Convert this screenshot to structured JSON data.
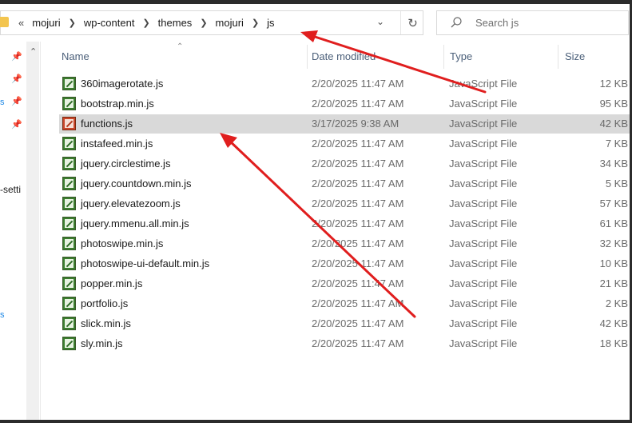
{
  "address": {
    "overflow_chevron": "«",
    "crumbs": [
      "mojuri",
      "wp-content",
      "themes",
      "mojuri",
      "js"
    ],
    "dropdown_icon": "chevron-down-icon",
    "refresh_icon": "refresh-icon"
  },
  "search": {
    "placeholder": "Search js",
    "icon": "search-icon"
  },
  "nav": {
    "partial_label": "-setti"
  },
  "columns": {
    "name": "Name",
    "date": "Date modified",
    "type": "Type",
    "size": "Size"
  },
  "files": [
    {
      "name": "360imagerotate.js",
      "date": "2/20/2025 11:47 AM",
      "type": "JavaScript File",
      "size": "12 KB"
    },
    {
      "name": "bootstrap.min.js",
      "date": "2/20/2025 11:47 AM",
      "type": "JavaScript File",
      "size": "95 KB"
    },
    {
      "name": "functions.js",
      "date": "3/17/2025 9:38 AM",
      "type": "JavaScript File",
      "size": "42 KB",
      "selected": true
    },
    {
      "name": "instafeed.min.js",
      "date": "2/20/2025 11:47 AM",
      "type": "JavaScript File",
      "size": "7 KB"
    },
    {
      "name": "jquery.circlestime.js",
      "date": "2/20/2025 11:47 AM",
      "type": "JavaScript File",
      "size": "34 KB"
    },
    {
      "name": "jquery.countdown.min.js",
      "date": "2/20/2025 11:47 AM",
      "type": "JavaScript File",
      "size": "5 KB"
    },
    {
      "name": "jquery.elevatezoom.js",
      "date": "2/20/2025 11:47 AM",
      "type": "JavaScript File",
      "size": "57 KB"
    },
    {
      "name": "jquery.mmenu.all.min.js",
      "date": "2/20/2025 11:47 AM",
      "type": "JavaScript File",
      "size": "61 KB"
    },
    {
      "name": "photoswipe.min.js",
      "date": "2/20/2025 11:47 AM",
      "type": "JavaScript File",
      "size": "32 KB"
    },
    {
      "name": "photoswipe-ui-default.min.js",
      "date": "2/20/2025 11:47 AM",
      "type": "JavaScript File",
      "size": "10 KB"
    },
    {
      "name": "popper.min.js",
      "date": "2/20/2025 11:47 AM",
      "type": "JavaScript File",
      "size": "21 KB"
    },
    {
      "name": "portfolio.js",
      "date": "2/20/2025 11:47 AM",
      "type": "JavaScript File",
      "size": "2 KB"
    },
    {
      "name": "slick.min.js",
      "date": "2/20/2025 11:47 AM",
      "type": "JavaScript File",
      "size": "42 KB"
    },
    {
      "name": "sly.min.js",
      "date": "2/20/2025 11:47 AM",
      "type": "JavaScript File",
      "size": "18 KB"
    }
  ],
  "colors": {
    "selected_row": "#d9d9d9",
    "annotation_arrow": "#e01e1e",
    "header_text": "#4c607a"
  }
}
